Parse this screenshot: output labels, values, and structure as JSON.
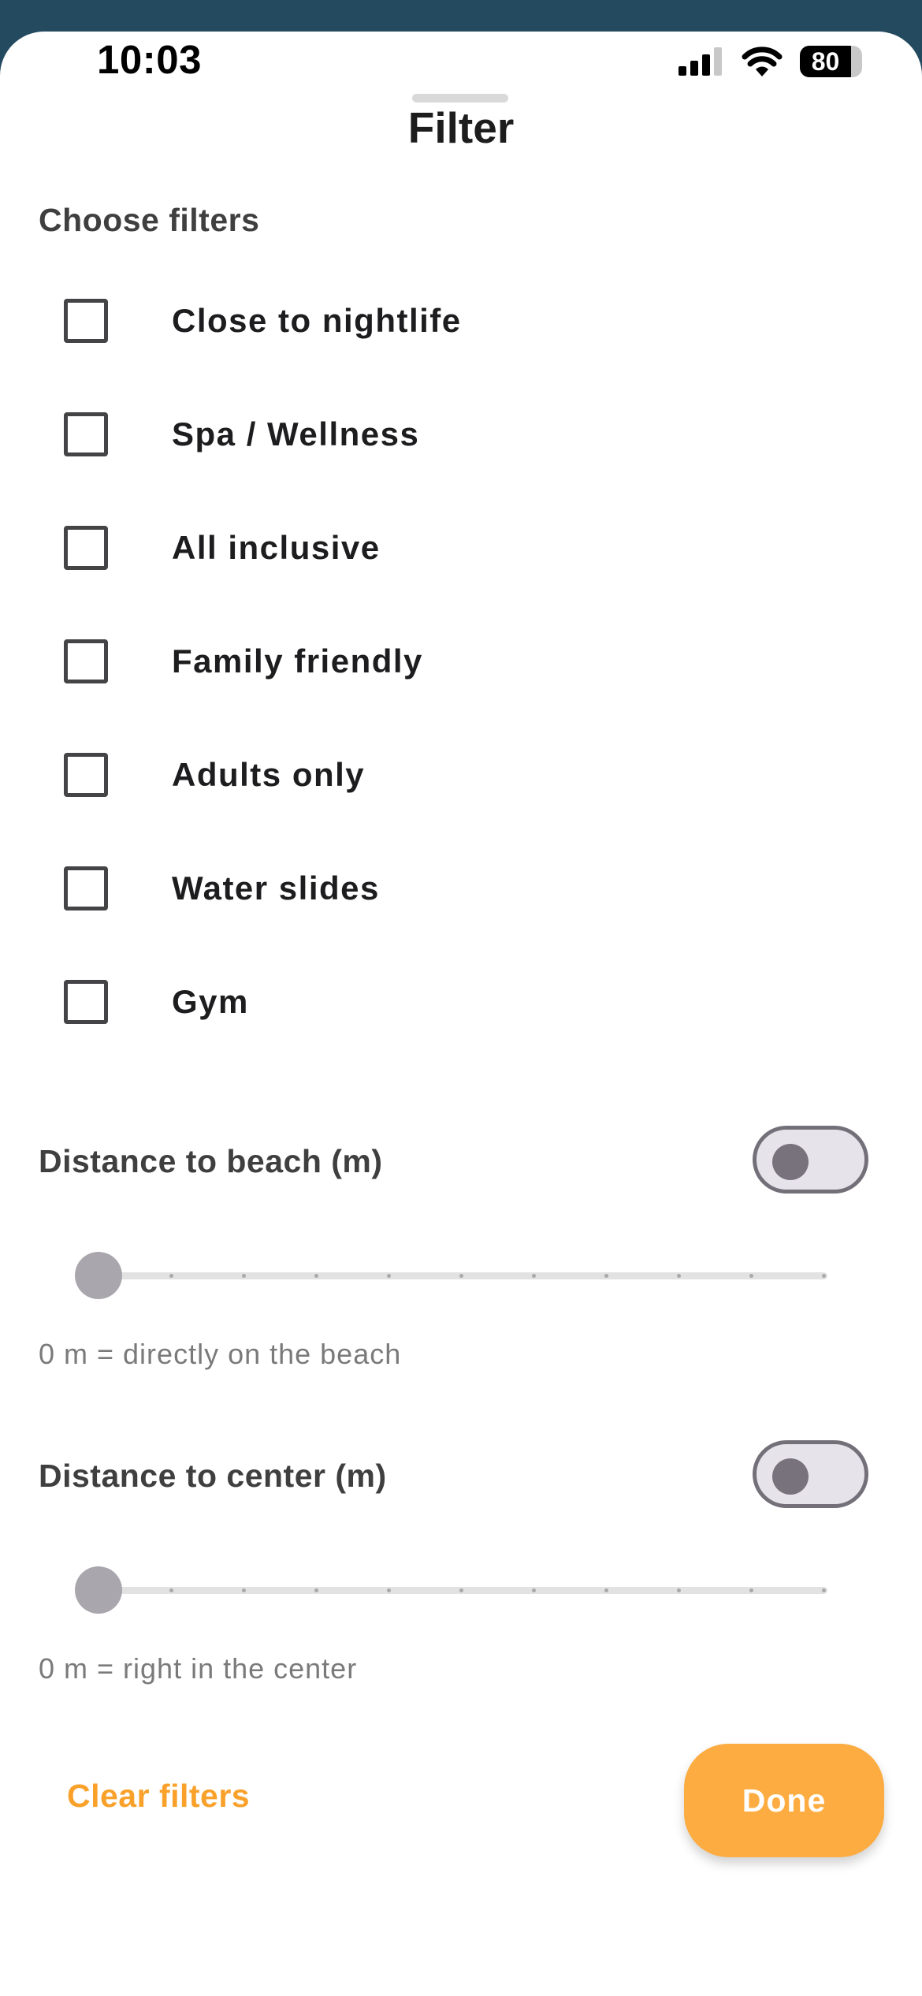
{
  "status_bar": {
    "time": "10:03",
    "battery": "80"
  },
  "title": "Filter",
  "choose_filters": {
    "heading": "Choose filters",
    "options": [
      {
        "label": "Close to nightlife",
        "checked": false
      },
      {
        "label": "Spa / Wellness",
        "checked": false
      },
      {
        "label": "All inclusive",
        "checked": false
      },
      {
        "label": "Family friendly",
        "checked": false
      },
      {
        "label": "Adults only",
        "checked": false
      },
      {
        "label": "Water slides",
        "checked": false
      },
      {
        "label": "Gym",
        "checked": false
      }
    ]
  },
  "beach": {
    "label": "Distance to beach (m)",
    "toggle_on": false,
    "slider_value": 0,
    "helper": "0 m = directly on the beach"
  },
  "center": {
    "label": "Distance to center (m)",
    "toggle_on": false,
    "slider_value": 0,
    "helper": "0 m = right in the center"
  },
  "footer": {
    "clear_label": "Clear filters",
    "done_label": "Done"
  },
  "colors": {
    "accent": "#fdac42",
    "accent_text": "#f9a12a",
    "backdrop": "#244a60"
  }
}
